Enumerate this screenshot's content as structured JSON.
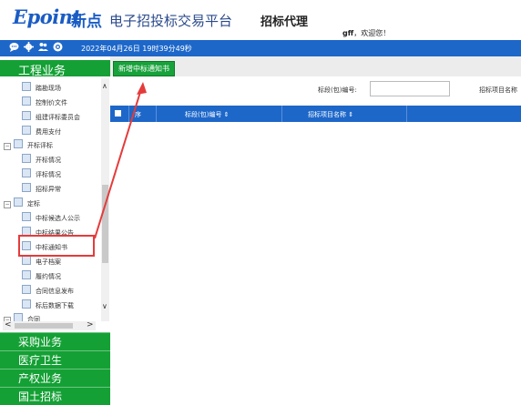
{
  "header": {
    "logo": "Epoint",
    "logo_cn": "新点",
    "platform": "电子招投标交易平台",
    "role": "招标代理",
    "user": "gff",
    "welcome": "，欢迎您！"
  },
  "topbar": {
    "icons": [
      "chat-icon",
      "settings-icon",
      "users-icon",
      "help-icon"
    ],
    "datetime": "2022年04月26日 19时39分49秒"
  },
  "sidebar": {
    "title": "工程业务",
    "tree": [
      {
        "label": "踏勘现场",
        "level": 2
      },
      {
        "label": "控制价文件",
        "level": 2
      },
      {
        "label": "组建评标委员会",
        "level": 2
      },
      {
        "label": "费用支付",
        "level": 2
      },
      {
        "label": "开标评标",
        "level": 1
      },
      {
        "label": "开标情况",
        "level": 2
      },
      {
        "label": "评标情况",
        "level": 2
      },
      {
        "label": "招标异常",
        "level": 2
      },
      {
        "label": "定标",
        "level": 1
      },
      {
        "label": "中标候选人公示",
        "level": 2
      },
      {
        "label": "中标结果公告",
        "level": 2
      },
      {
        "label": "中标通知书",
        "level": 2
      },
      {
        "label": "电子档案",
        "level": 2
      },
      {
        "label": "履约情况",
        "level": 2
      },
      {
        "label": "合同信息发布",
        "level": 2
      },
      {
        "label": "标后数据下载",
        "level": 2
      },
      {
        "label": "合同",
        "level": 1
      }
    ],
    "categories": [
      "采购业务",
      "医疗卫生",
      "产权业务",
      "国土招标"
    ]
  },
  "main": {
    "new_button": "新增中标通知书",
    "search": {
      "section_label": "标段(包)编号:",
      "section_value": "",
      "project_label": "招标项目名称"
    },
    "table": {
      "columns": [
        "序",
        "标段(包)编号 ⇕",
        "招标项目名称 ⇕"
      ]
    }
  },
  "colors": {
    "green": "#14a035",
    "blue": "#1d67c9",
    "highlight": "#e53b3b"
  }
}
